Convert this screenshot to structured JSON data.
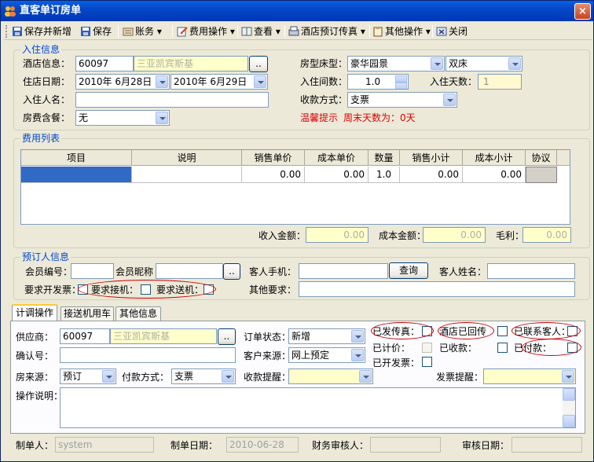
{
  "window": {
    "title": "直客单订房单",
    "close": "×"
  },
  "toolbar": {
    "save_new": "保存并新增",
    "save": "保存",
    "accounts": "账务",
    "fee_ops": "费用操作",
    "view": "查看",
    "hotel_fax": "酒店预订传真",
    "other_ops": "其他操作",
    "close": "关闭",
    "dropdown_arrow": "▾"
  },
  "stay": {
    "group_title": "入住信息",
    "hotel_label": "酒店信息：",
    "hotel_code": "60097",
    "hotel_name": "三亚凯宾斯基",
    "browse": "..",
    "room_type_label": "房型床型：",
    "room_type": "豪华园景",
    "bed_type": "双床",
    "date_label": "住店日期：",
    "checkin": "2010年 6月28日",
    "checkout": "2010年 6月29日",
    "rooms_label": "入住间数：",
    "rooms": "1.0",
    "days_label": "入住天数：",
    "days": "1",
    "guest_label": "入住人名：",
    "guest": "",
    "payment_label": "收款方式：",
    "payment": "支票",
    "meal_label": "房费含餐：",
    "meal": "无",
    "tip_label": "温馨提示",
    "tip_text": "周末天数为：0天"
  },
  "fees": {
    "group_title": "费用列表",
    "columns": [
      "项目",
      "说明",
      "销售单价",
      "成本单价",
      "数量",
      "销售小计",
      "成本小计",
      "协议"
    ],
    "row": [
      "",
      "",
      "0.00",
      "0.00",
      "1.0",
      "0.00",
      "0.00",
      ""
    ],
    "income_label": "收入金额：",
    "income": "0.00",
    "cost_label": "成本金额：",
    "cost": "0.00",
    "profit_label": "毛利：",
    "profit": "0.00"
  },
  "booker": {
    "group_title": "预订人信息",
    "member_no_label": "会员编号：",
    "member_nick_label": "会员昵称",
    "browse": "..",
    "mobile_label": "客人手机：",
    "query": "查询",
    "name_label": "客人姓名：",
    "invoice_label": "要求开发票：",
    "pickup_label": "要求接机：",
    "dropoff_label": "要求送机：",
    "other_label": "其他要求："
  },
  "tabs": [
    "计调操作",
    "接送机用车",
    "其他信息"
  ],
  "ops": {
    "supplier_label": "供应商：",
    "supplier_code": "60097",
    "supplier_name": "三亚凯宾斯基",
    "browse": "..",
    "status_label": "订单状态：",
    "status": "新增",
    "confirm_label": "确认号：",
    "source_label": "客户来源：",
    "source": "网上预定",
    "room_source_label": "房来源：",
    "room_source": "预订",
    "pay_label": "付款方式：",
    "pay": "支票",
    "collect_label": "收款提醒：",
    "collect": "",
    "invoice_remind_label": "发票提醒：",
    "invoice_remind": "",
    "note_label": "操作说明：",
    "fax_sent": "已发传真：",
    "hotel_reply": "酒店已回传",
    "contacted": "已联系客人：",
    "priced": "已计价：",
    "collected": "已收款：",
    "paid": "已付款：",
    "invoiced": "已开发票："
  },
  "footer": {
    "maker_label": "制单人：",
    "maker": "system",
    "date_label": "制单日期：",
    "date": "2010-06-28",
    "auditor_label": "财务审核人：",
    "auditor": "",
    "audit_date_label": "审核日期：",
    "audit_date": ""
  }
}
